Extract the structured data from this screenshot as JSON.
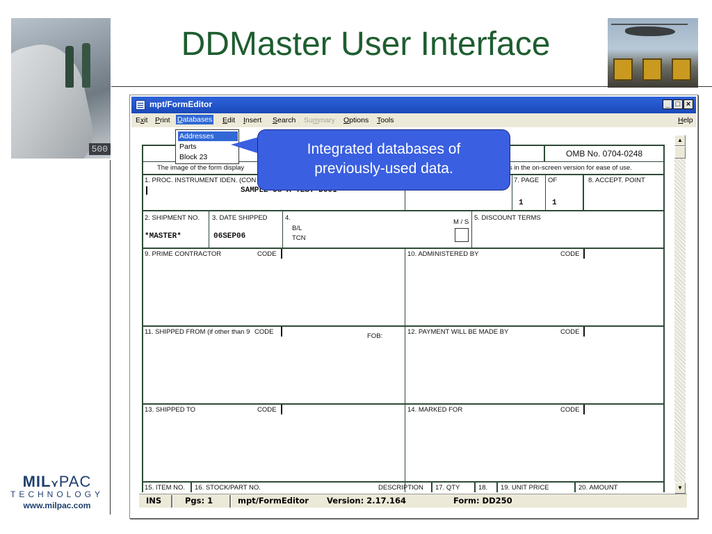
{
  "slide": {
    "title": "DDMaster User Interface",
    "photo_left_number": "500",
    "logo": {
      "brand_bold": "MIL",
      "brand_light": "PAC",
      "tagline": "TECHNOLOGY",
      "url": "www.milpac.com"
    }
  },
  "window": {
    "title": "mpt/FormEditor",
    "buttons": {
      "minimize": "_",
      "maximize": "□",
      "close": "×"
    },
    "menu": [
      {
        "key": "exit",
        "label": "Exit"
      },
      {
        "key": "print",
        "label": "Print"
      },
      {
        "key": "databases",
        "label": "Databases"
      },
      {
        "key": "edit",
        "label": "Edit"
      },
      {
        "key": "insert",
        "label": "Insert"
      },
      {
        "key": "search",
        "label": "Search"
      },
      {
        "key": "summary",
        "label": "Summary",
        "disabled": true
      },
      {
        "key": "options",
        "label": "Options"
      },
      {
        "key": "tools",
        "label": "Tools"
      },
      {
        "key": "help",
        "label": "Help"
      }
    ],
    "dropdown": [
      "Addresses",
      "Parts",
      "Block 23"
    ]
  },
  "callout": {
    "line1": "Integrated databases of",
    "line2": "previously-used data."
  },
  "form": {
    "omb": "OMB No. 0704-0248",
    "notice_left": "The image of the form display",
    "notice_right": "s in the on-screen version for ease of use.",
    "f1_label": "1. PROC. INSTRUMENT IDEN. (CON",
    "f1_value": "SAMPLE-98-A-TEST D001",
    "f7_label": "7. PAGE",
    "f7_of": "OF",
    "f7_page": "1",
    "f7_total": "1",
    "f8_label": "8. ACCEPT. POINT",
    "f2_label": "2. SHIPMENT NO.",
    "f2_value": "*MASTER*",
    "f3_label": "3. DATE SHIPPED",
    "f3_value": "06SEP06",
    "f4_label": "4.",
    "f4_bl": "B/L",
    "f4_tcn": "TCN",
    "ms_label": "M / S",
    "f5_label": "5. DISCOUNT TERMS",
    "f9_label": "9. PRIME CONTRACTOR",
    "f9_code": "CODE",
    "f10_label": "10. ADMINISTERED BY",
    "f10_code": "CODE",
    "f11_label": "11. SHIPPED FROM (if other than 9",
    "f11_code": "CODE",
    "fob": "FOB:",
    "f12_label": "12. PAYMENT WILL BE MADE BY",
    "f12_code": "CODE",
    "f13_label": "13. SHIPPED TO",
    "f13_code": "CODE",
    "f14_label": "14. MARKED FOR",
    "f14_code": "CODE",
    "f15_label": "15. ITEM NO.",
    "f16_label": "16. STOCK/PART NO.",
    "desc_label": "DESCRIPTION",
    "f17_label": "17. QTY",
    "f18_label": "18.",
    "f19_label": "19. UNIT PRICE",
    "f20_label": "20. AMOUNT"
  },
  "status": {
    "mode": "INS",
    "pages": "Pgs: 1",
    "app": "mpt/FormEditor",
    "version": "Version: 2.17.164",
    "form": "Form: DD250"
  }
}
